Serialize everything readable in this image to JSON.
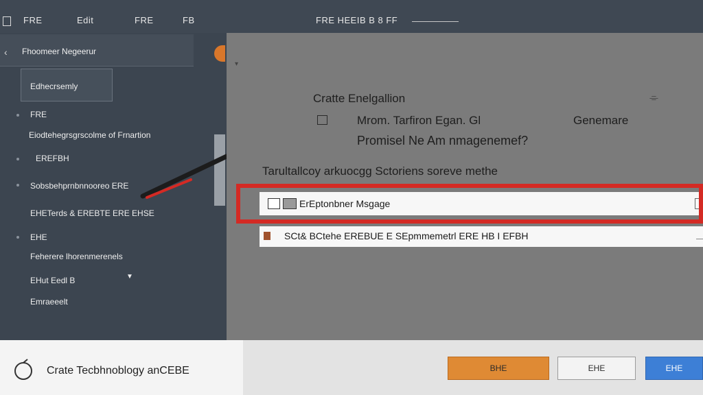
{
  "topbar": {
    "item1": "FRE",
    "item2": "Edit",
    "item3": "FRE",
    "item4": "FB",
    "item5": "FRE HEEIB B 8 FF"
  },
  "sidebar": {
    "header_label": "Fhoomeer Negeerur",
    "selected_label": "Edhecrsemly",
    "items": [
      "FRE",
      "Eiodtehegrsgrscolme of Frnartion",
      "EREFBH",
      "Sobsbehprnbnnooreo ERE",
      "EHETerds & EREBTE ERE EHSE",
      "EHE",
      "Feherere lhorenmerenels",
      "EHut Eedl B",
      "Emraeeelt"
    ]
  },
  "dialog": {
    "title": "Cratte Enelgallion",
    "close_glyph": "⌯",
    "label1": "Mrom. Tarfiron Egan. Gl",
    "label2": "Promisel Ne Am nmagenemef?",
    "right_label": "Genemare",
    "description": "Tarultallcoy arkuocgg Sctoriens soreve methe",
    "rows": [
      {
        "text": "ErEptonbner Msgage"
      },
      {
        "text": "SCt& BCtehe EREBUE E SEpmmemetrl ERE HB I EFBH"
      }
    ]
  },
  "footer": {
    "app_label": "Crate Tecbhnoblogy anCEBE",
    "btn_primary": "BHE",
    "btn_secondary": "EHE",
    "btn_blue": "EHE"
  },
  "colors": {
    "sidebar_bg": "#3c4550",
    "highlight": "#d42a24",
    "primary_button": "#df8a34",
    "blue_button": "#3d7fd6"
  },
  "icons": [
    "app-icon",
    "collapse-icon",
    "close-icon",
    "checkbox-icon",
    "pen-annotation-icon",
    "logo-icon"
  ]
}
